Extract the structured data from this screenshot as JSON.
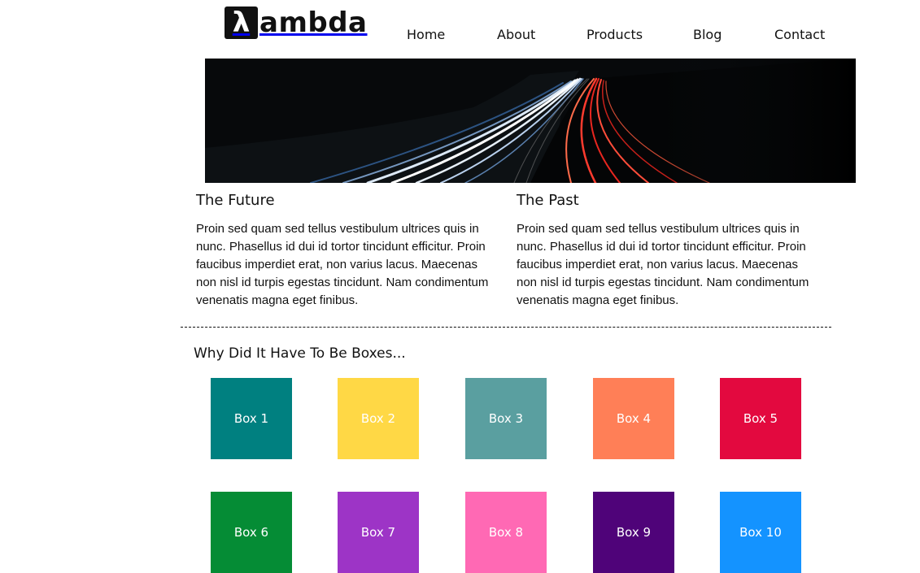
{
  "header": {
    "logo_symbol": "λ",
    "logo_text": "ambda",
    "nav": [
      "Home",
      "About",
      "Products",
      "Blog",
      "Contact"
    ]
  },
  "hero": {
    "description": ""
  },
  "columns": [
    {
      "title": "The Future",
      "text": "Proin sed quam sed tellus vestibulum ultrices quis in nunc. Phasellus id dui id tortor tincidunt efficitur. Proin faucibus imperdiet erat, non varius lacus. Maecenas non nisl id turpis egestas tincidunt. Nam condimentum venenatis magna eget finibus."
    },
    {
      "title": "The Past",
      "text": "Proin sed quam sed tellus vestibulum ultrices quis in nunc. Phasellus id dui id tortor tincidunt efficitur. Proin faucibus imperdiet erat, non varius lacus. Maecenas non nisl id turpis egestas tincidunt. Nam condimentum venenatis magna eget finibus."
    }
  ],
  "boxes_section": {
    "title": "Why Did It Have To Be Boxes...",
    "boxes": [
      {
        "label": "Box 1",
        "color": "#008080"
      },
      {
        "label": "Box 2",
        "color": "#FFD845"
      },
      {
        "label": "Box 3",
        "color": "#5A9FA0"
      },
      {
        "label": "Box 4",
        "color": "#FF7F57"
      },
      {
        "label": "Box 5",
        "color": "#E3093F"
      },
      {
        "label": "Box 6",
        "color": "#058C35"
      },
      {
        "label": "Box 7",
        "color": "#9D34C6"
      },
      {
        "label": "Box 8",
        "color": "#FF69B4"
      },
      {
        "label": "Box 9",
        "color": "#4F0379"
      },
      {
        "label": "Box 10",
        "color": "#1493FF"
      }
    ]
  }
}
